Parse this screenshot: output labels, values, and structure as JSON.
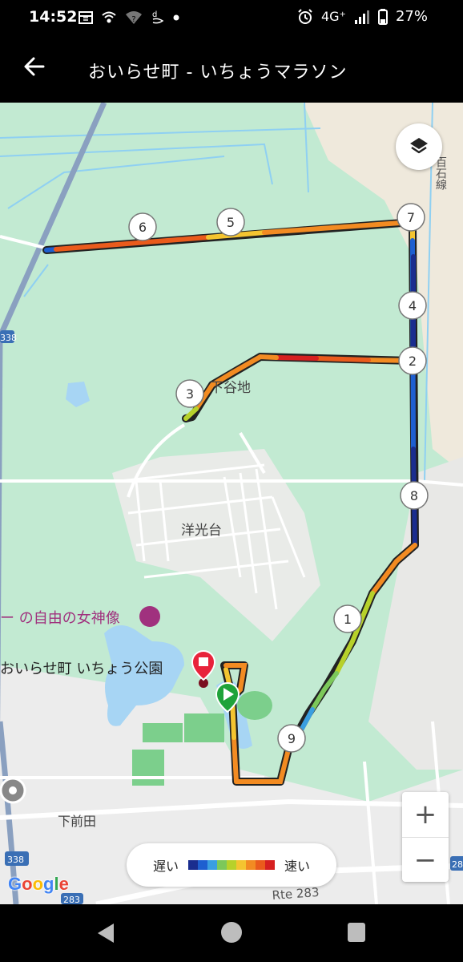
{
  "status_bar": {
    "time": "14:52",
    "left_icons": [
      "calendar-icon",
      "wifi-calling-icon",
      "wifi-question-icon",
      "docomo-icon",
      "dot-icon"
    ],
    "network": "4G⁺",
    "battery": "27%"
  },
  "app_bar": {
    "title": "おいらせ町 - いちょうマラソン"
  },
  "map": {
    "labels": {
      "shimoyachi": "下谷地",
      "yokodai": "洋光台",
      "statue": "ー の自由の女神像",
      "park": "おいらせ町 いちょう公園",
      "shimomaeda": "下前田",
      "line_road": "百石線",
      "route_283_text": "Rte 283",
      "shield_338_left": "338",
      "shield_338_bottom": "338",
      "shield_283": "283",
      "shield_right": "28"
    },
    "km_markers": [
      "1",
      "2",
      "3",
      "4",
      "5",
      "6",
      "7",
      "8",
      "9"
    ]
  },
  "legend": {
    "slow_label": "遅い",
    "fast_label": "速い",
    "colors": [
      "#1a2d8f",
      "#1e5fd0",
      "#3a9ee0",
      "#7cc85a",
      "#b7d12a",
      "#f4c430",
      "#f28b22",
      "#ea5b1c",
      "#d62020"
    ]
  },
  "zoom": {
    "in_label": "+",
    "out_label": "−"
  },
  "attribution": {
    "google": [
      "G",
      "o",
      "o",
      "g",
      "l",
      "e"
    ],
    "google_colors": [
      "#4285F4",
      "#EA4335",
      "#FBBC05",
      "#4285F4",
      "#34A853",
      "#EA4335"
    ]
  }
}
